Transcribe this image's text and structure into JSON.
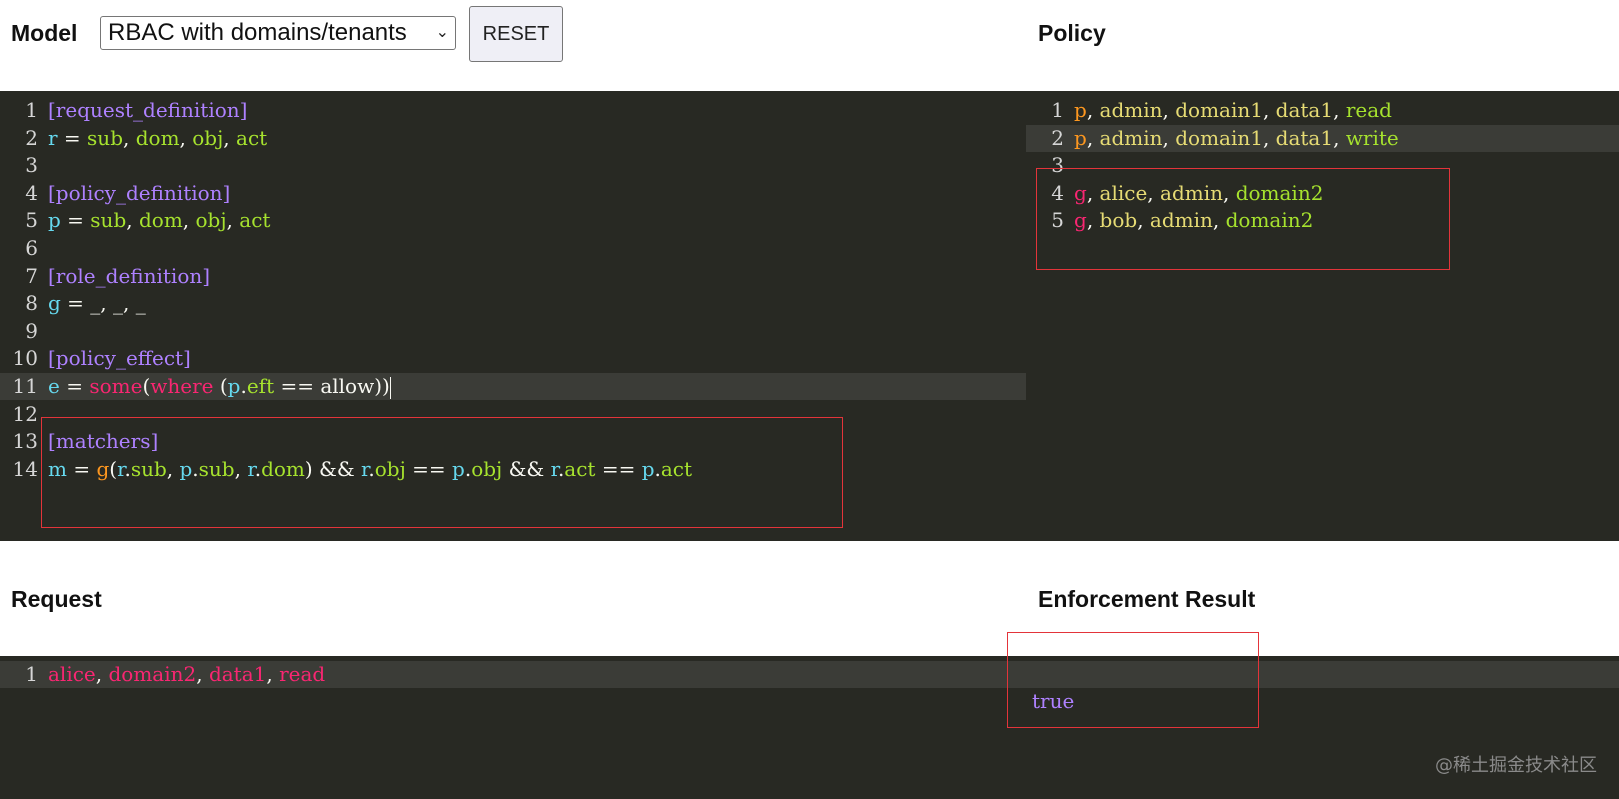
{
  "model": {
    "heading": "Model",
    "select_value": "RBAC with domains/tenants",
    "reset_label": "RESET",
    "lines": [
      {
        "n": "1",
        "tokens": [
          {
            "t": "[request_definition]",
            "c": "t-section"
          }
        ]
      },
      {
        "n": "2",
        "tokens": [
          {
            "t": "r",
            "c": "t-key"
          },
          {
            "t": " = ",
            "c": "t-op"
          },
          {
            "t": "sub",
            "c": "t-field"
          },
          {
            "t": ", ",
            "c": "t-punc"
          },
          {
            "t": "dom",
            "c": "t-field"
          },
          {
            "t": ", ",
            "c": "t-punc"
          },
          {
            "t": "obj",
            "c": "t-field"
          },
          {
            "t": ", ",
            "c": "t-punc"
          },
          {
            "t": "act",
            "c": "t-field"
          }
        ]
      },
      {
        "n": "3",
        "tokens": []
      },
      {
        "n": "4",
        "tokens": [
          {
            "t": "[policy_definition]",
            "c": "t-section"
          }
        ]
      },
      {
        "n": "5",
        "tokens": [
          {
            "t": "p",
            "c": "t-key"
          },
          {
            "t": " = ",
            "c": "t-op"
          },
          {
            "t": "sub",
            "c": "t-field"
          },
          {
            "t": ", ",
            "c": "t-punc"
          },
          {
            "t": "dom",
            "c": "t-field"
          },
          {
            "t": ", ",
            "c": "t-punc"
          },
          {
            "t": "obj",
            "c": "t-field"
          },
          {
            "t": ", ",
            "c": "t-punc"
          },
          {
            "t": "act",
            "c": "t-field"
          }
        ]
      },
      {
        "n": "6",
        "tokens": []
      },
      {
        "n": "7",
        "tokens": [
          {
            "t": "[role_definition]",
            "c": "t-section"
          }
        ]
      },
      {
        "n": "8",
        "tokens": [
          {
            "t": "g",
            "c": "t-key"
          },
          {
            "t": " = _, _, _",
            "c": "t-op"
          }
        ]
      },
      {
        "n": "9",
        "tokens": []
      },
      {
        "n": "10",
        "tokens": [
          {
            "t": "[policy_effect]",
            "c": "t-section"
          }
        ]
      },
      {
        "n": "11",
        "active": true,
        "tokens": [
          {
            "t": "e",
            "c": "t-key"
          },
          {
            "t": " = ",
            "c": "t-op"
          },
          {
            "t": "some",
            "c": "t-kw"
          },
          {
            "t": "(",
            "c": "t-op"
          },
          {
            "t": "where",
            "c": "t-kw"
          },
          {
            "t": " (",
            "c": "t-op"
          },
          {
            "t": "p",
            "c": "t-key"
          },
          {
            "t": ".",
            "c": "t-op"
          },
          {
            "t": "eft",
            "c": "t-field"
          },
          {
            "t": " == allow))",
            "c": "t-op"
          }
        ]
      },
      {
        "n": "12",
        "tokens": []
      },
      {
        "n": "13",
        "tokens": [
          {
            "t": "[matchers]",
            "c": "t-section"
          }
        ]
      },
      {
        "n": "14",
        "tokens": [
          {
            "t": "m",
            "c": "t-key"
          },
          {
            "t": " = ",
            "c": "t-op"
          },
          {
            "t": "g",
            "c": "t-p"
          },
          {
            "t": "(",
            "c": "t-op"
          },
          {
            "t": "r",
            "c": "t-key"
          },
          {
            "t": ".",
            "c": "t-op"
          },
          {
            "t": "sub",
            "c": "t-field"
          },
          {
            "t": ", ",
            "c": "t-punc"
          },
          {
            "t": "p",
            "c": "t-key"
          },
          {
            "t": ".",
            "c": "t-op"
          },
          {
            "t": "sub",
            "c": "t-field"
          },
          {
            "t": ", ",
            "c": "t-punc"
          },
          {
            "t": "r",
            "c": "t-key"
          },
          {
            "t": ".",
            "c": "t-op"
          },
          {
            "t": "dom",
            "c": "t-field"
          },
          {
            "t": ") && ",
            "c": "t-op"
          },
          {
            "t": "r",
            "c": "t-key"
          },
          {
            "t": ".",
            "c": "t-op"
          },
          {
            "t": "obj",
            "c": "t-field"
          },
          {
            "t": " == ",
            "c": "t-op"
          },
          {
            "t": "p",
            "c": "t-key"
          },
          {
            "t": ".",
            "c": "t-op"
          },
          {
            "t": "obj",
            "c": "t-field"
          },
          {
            "t": " && ",
            "c": "t-op"
          },
          {
            "t": "r",
            "c": "t-key"
          },
          {
            "t": ".",
            "c": "t-op"
          },
          {
            "t": "act",
            "c": "t-field"
          },
          {
            "t": " == ",
            "c": "t-op"
          },
          {
            "t": "p",
            "c": "t-key"
          },
          {
            "t": ".",
            "c": "t-op"
          },
          {
            "t": "act",
            "c": "t-field"
          }
        ]
      }
    ]
  },
  "policy": {
    "heading": "Policy",
    "lines": [
      {
        "n": "1",
        "tokens": [
          {
            "t": "p",
            "c": "t-p"
          },
          {
            "t": ", ",
            "c": "t-punc"
          },
          {
            "t": "admin",
            "c": "t-str"
          },
          {
            "t": ", ",
            "c": "t-punc"
          },
          {
            "t": "domain1",
            "c": "t-str"
          },
          {
            "t": ", ",
            "c": "t-punc"
          },
          {
            "t": "data1",
            "c": "t-str"
          },
          {
            "t": ", ",
            "c": "t-punc"
          },
          {
            "t": "read",
            "c": "t-field"
          }
        ]
      },
      {
        "n": "2",
        "active": true,
        "tokens": [
          {
            "t": "p",
            "c": "t-p"
          },
          {
            "t": ", ",
            "c": "t-punc"
          },
          {
            "t": "admin",
            "c": "t-str"
          },
          {
            "t": ", ",
            "c": "t-punc"
          },
          {
            "t": "domain1",
            "c": "t-str"
          },
          {
            "t": ", ",
            "c": "t-punc"
          },
          {
            "t": "data1",
            "c": "t-str"
          },
          {
            "t": ", ",
            "c": "t-punc"
          },
          {
            "t": "write",
            "c": "t-field"
          }
        ]
      },
      {
        "n": "3",
        "tokens": []
      },
      {
        "n": "4",
        "tokens": [
          {
            "t": "g",
            "c": "t-g"
          },
          {
            "t": ", ",
            "c": "t-punc"
          },
          {
            "t": "alice",
            "c": "t-str"
          },
          {
            "t": ", ",
            "c": "t-punc"
          },
          {
            "t": "admin",
            "c": "t-str"
          },
          {
            "t": ", ",
            "c": "t-punc"
          },
          {
            "t": "domain2",
            "c": "t-field"
          }
        ]
      },
      {
        "n": "5",
        "tokens": [
          {
            "t": "g",
            "c": "t-g"
          },
          {
            "t": ", ",
            "c": "t-punc"
          },
          {
            "t": "bob",
            "c": "t-str"
          },
          {
            "t": ", ",
            "c": "t-punc"
          },
          {
            "t": "admin",
            "c": "t-str"
          },
          {
            "t": ", ",
            "c": "t-punc"
          },
          {
            "t": "domain2",
            "c": "t-field"
          }
        ]
      }
    ]
  },
  "request": {
    "heading": "Request",
    "lines": [
      {
        "n": "1",
        "active": true,
        "tokens": [
          {
            "t": "alice",
            "c": "t-red"
          },
          {
            "t": ", ",
            "c": "t-punc"
          },
          {
            "t": "domain2",
            "c": "t-red"
          },
          {
            "t": ", ",
            "c": "t-punc"
          },
          {
            "t": "data1",
            "c": "t-red"
          },
          {
            "t": ", ",
            "c": "t-punc"
          },
          {
            "t": "read",
            "c": "t-red"
          }
        ]
      }
    ]
  },
  "result": {
    "heading": "Enforcement Result",
    "value": "true"
  },
  "watermark": "@稀土掘金技术社区",
  "colors": {
    "editor_bg": "#282923",
    "section": "#ae81ff",
    "key": "#66d9ef",
    "field": "#a6e22e",
    "keyword": "#f92672",
    "param": "#fd971f",
    "string": "#e6db74",
    "highlight_box": "#e3343a"
  }
}
